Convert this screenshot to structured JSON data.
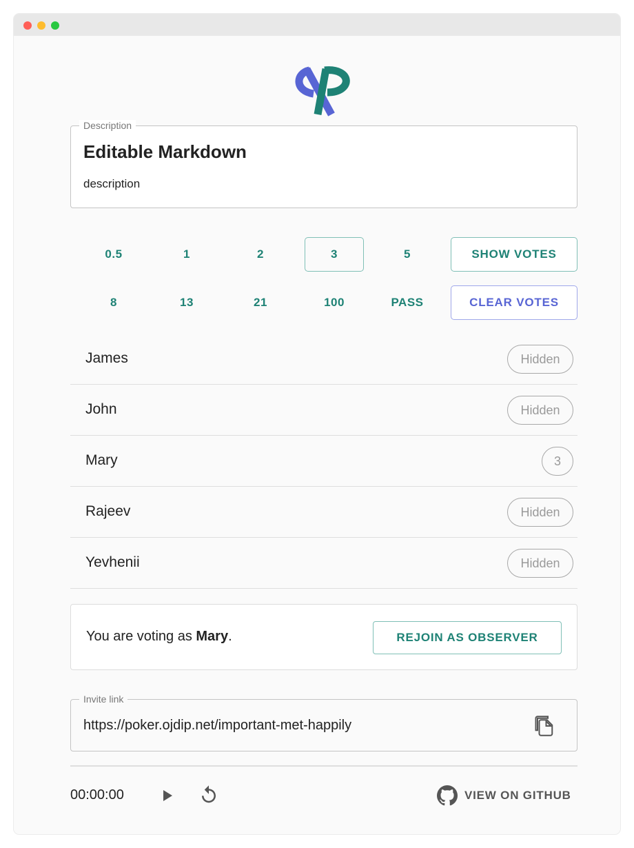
{
  "description": {
    "legend": "Description",
    "title": "Editable Markdown",
    "body": "description"
  },
  "votes": {
    "options": [
      "0.5",
      "1",
      "2",
      "3",
      "5",
      "8",
      "13",
      "21",
      "100",
      "PASS"
    ],
    "selected": "3",
    "show_votes_label": "SHOW VOTES",
    "clear_votes_label": "CLEAR VOTES"
  },
  "players": [
    {
      "name": "James",
      "status": "Hidden"
    },
    {
      "name": "John",
      "status": "Hidden"
    },
    {
      "name": "Mary",
      "status": "3"
    },
    {
      "name": "Rajeev",
      "status": "Hidden"
    },
    {
      "name": "Yevhenii",
      "status": "Hidden"
    }
  ],
  "voting": {
    "prefix": "You are voting as ",
    "user": "Mary",
    "suffix": ".",
    "rejoin_label": "REJOIN AS OBSERVER"
  },
  "invite": {
    "legend": "Invite link",
    "url": "https://poker.ojdip.net/important-met-happily"
  },
  "footer": {
    "timer": "00:00:00",
    "github_label": "VIEW ON GITHUB"
  },
  "colors": {
    "teal": "#1e8275",
    "indigo": "#5865d4"
  },
  "icons": {
    "logo": "planning-poker-logo",
    "copy": "copy-icon",
    "play": "play-icon",
    "reset": "reset-icon",
    "github": "github-icon"
  }
}
